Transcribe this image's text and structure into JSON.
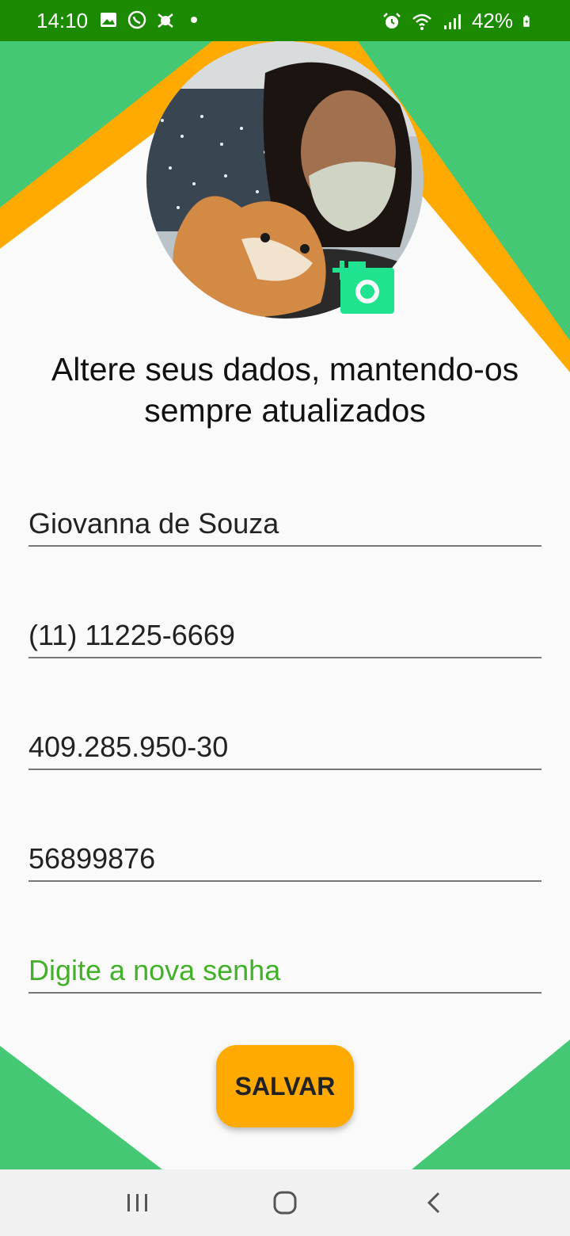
{
  "status_bar": {
    "time": "14:10",
    "battery": "42%",
    "left_icons": [
      "image-icon",
      "whatsapp-icon",
      "settings-bug-icon",
      "dot-icon"
    ],
    "right_icons": [
      "alarm-icon",
      "wifi-icon",
      "signal-icon",
      "battery-icon"
    ]
  },
  "colors": {
    "status_green": "#1b8a00",
    "green": "#45c873",
    "orange": "#ffaa00",
    "camera_teal": "#1fe38f",
    "placeholder_green": "#43b02a"
  },
  "profile": {
    "avatar": "profile-photo",
    "camera_icon": "add-photo-camera-icon"
  },
  "heading": "Altere seus dados, mantendo-os sempre atualizados",
  "fields": {
    "name": {
      "value": "Giovanna de Souza"
    },
    "phone": {
      "value": "(11) 11225-6669"
    },
    "cpf": {
      "value": "409.285.950-30"
    },
    "password_old": {
      "value": "56899876"
    },
    "new_password": {
      "value": "",
      "placeholder": "Digite a nova senha"
    }
  },
  "save_button": {
    "label": "SALVAR"
  },
  "nav_bar": {
    "icons": [
      "recent-apps-icon",
      "home-icon",
      "back-icon"
    ]
  }
}
